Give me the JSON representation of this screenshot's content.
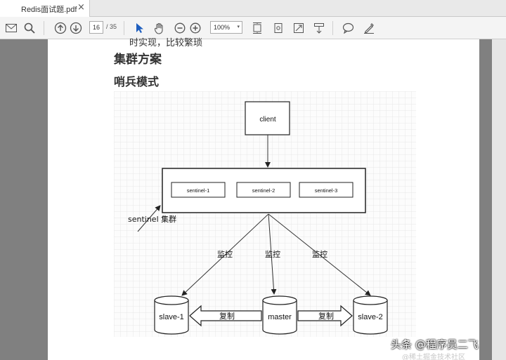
{
  "tab": {
    "title": "Redis面试题.pdf",
    "close": "×"
  },
  "toolbar": {
    "page_current": "16",
    "page_total": "/ 35",
    "zoom": "100%",
    "zoom_arrow": "▾"
  },
  "document": {
    "cut_line": "时实现，比较繁琐",
    "heading_cluster": "集群方案",
    "heading_sentinel": "哨兵模式"
  },
  "diagram": {
    "client": "client",
    "sentinels": [
      "sentinel-1",
      "sentinel-2",
      "sentinel-3"
    ],
    "cluster_label": "sentinel 集群",
    "monitor_labels": [
      "监控",
      "监控",
      "监控"
    ],
    "nodes": {
      "slave1": "slave-1",
      "master": "master",
      "slave2": "slave-2"
    },
    "replicate_labels": [
      "复制",
      "复制"
    ]
  },
  "watermark": "头条 @程序员二飞",
  "watermark_faint": "@稀土掘金技术社区"
}
